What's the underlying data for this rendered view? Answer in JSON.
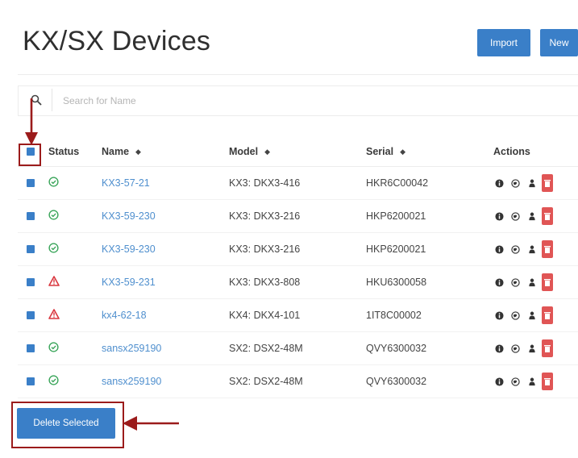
{
  "page": {
    "title": "KX/SX Devices",
    "import_label": "Import",
    "new_label": "New"
  },
  "search": {
    "placeholder": "Search for Name",
    "icon": "search-icon"
  },
  "table": {
    "headers": {
      "status": "Status",
      "name": "Name",
      "model": "Model",
      "serial": "Serial",
      "actions": "Actions"
    },
    "rows": [
      {
        "status": "ok",
        "name": "KX3-57-21",
        "model": "KX3: DKX3-416",
        "serial": "HKR6C00042"
      },
      {
        "status": "ok",
        "name": "KX3-59-230",
        "model": "KX3: DKX3-216",
        "serial": "HKP6200021"
      },
      {
        "status": "ok",
        "name": "KX3-59-230",
        "model": "KX3: DKX3-216",
        "serial": "HKP6200021"
      },
      {
        "status": "warning",
        "name": "KX3-59-231",
        "model": "KX3: DKX3-808",
        "serial": "HKU6300058"
      },
      {
        "status": "warning",
        "name": "kx4-62-18",
        "model": "KX4: DKX4-101",
        "serial": "1IT8C00002"
      },
      {
        "status": "ok",
        "name": "sansx259190",
        "model": "SX2: DSX2-48M",
        "serial": "QVY6300032"
      },
      {
        "status": "ok",
        "name": "sansx259190",
        "model": "SX2: DSX2-48M",
        "serial": "QVY6300032"
      }
    ]
  },
  "footer": {
    "delete_label": "Delete Selected"
  },
  "colors": {
    "primary": "#3a7fc8",
    "link": "#4f8fce",
    "ok": "#3aa55a",
    "warning": "#d9363e",
    "danger": "#e05555",
    "annotation": "#9b1b1b"
  }
}
